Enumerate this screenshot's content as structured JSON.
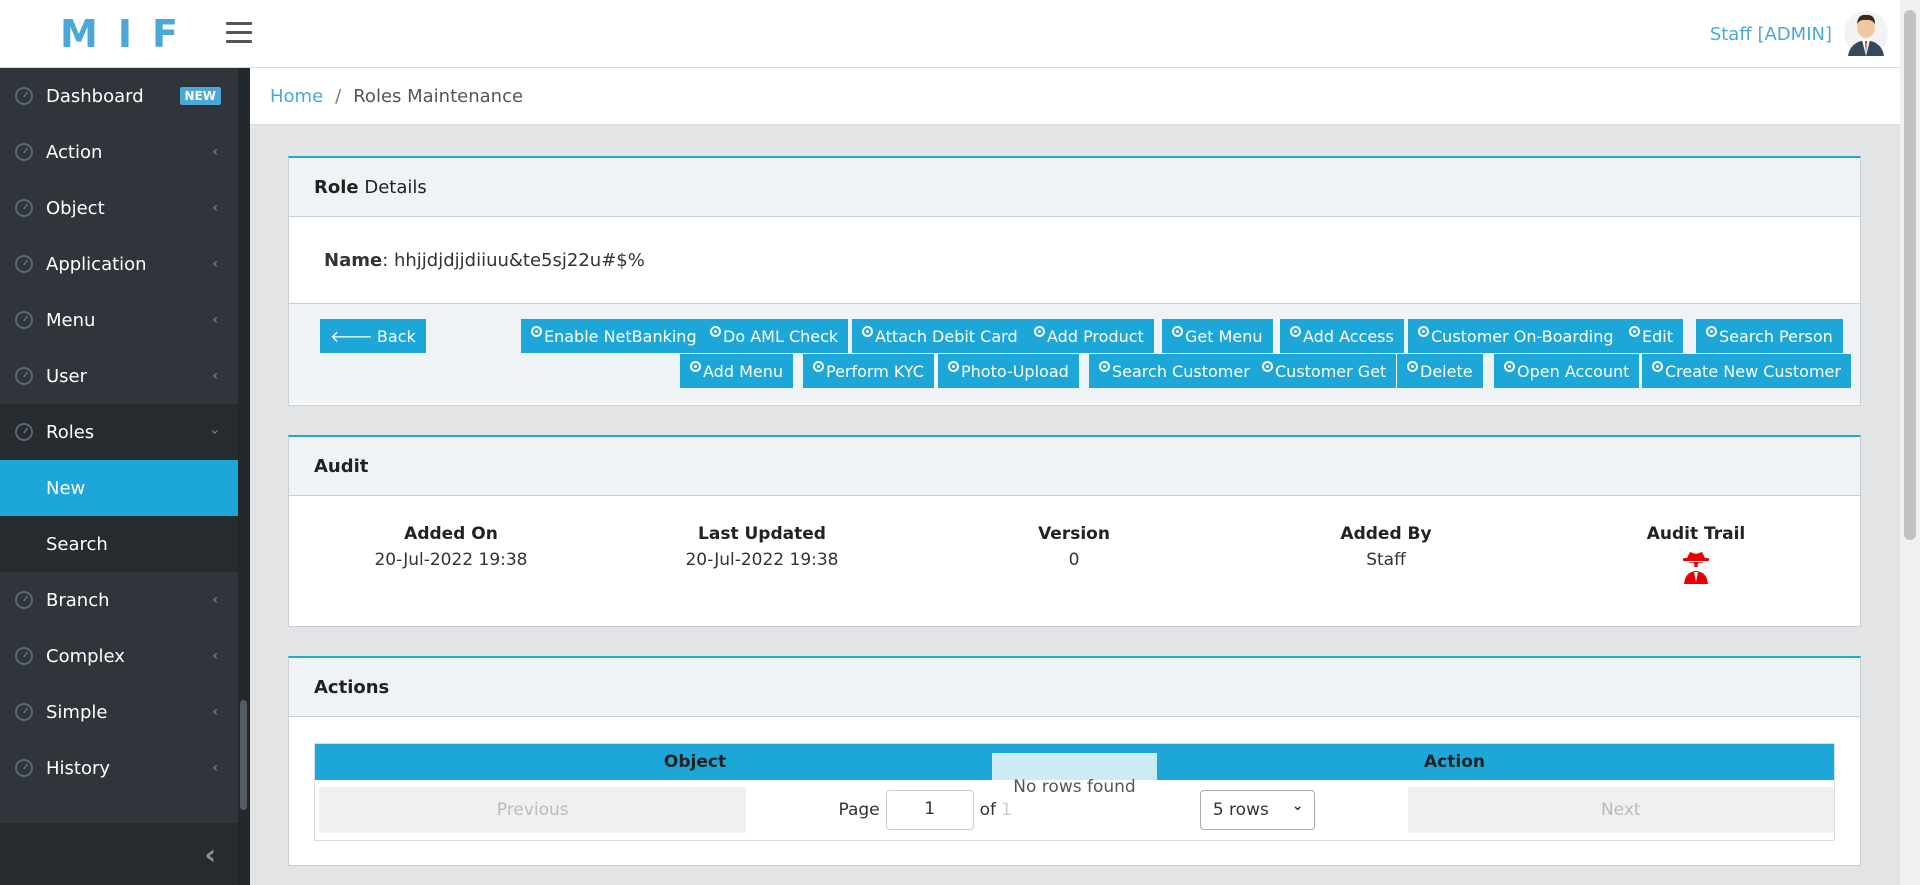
{
  "header": {
    "logo": "MIF",
    "user": "Staff [ADMIN]"
  },
  "sidebar": {
    "items": [
      {
        "label": "Dashboard",
        "badge": "NEW"
      },
      {
        "label": "Action"
      },
      {
        "label": "Object"
      },
      {
        "label": "Application"
      },
      {
        "label": "Menu"
      },
      {
        "label": "User"
      },
      {
        "label": "Roles"
      },
      {
        "label": "Branch"
      },
      {
        "label": "Complex"
      },
      {
        "label": "Simple"
      },
      {
        "label": "History"
      }
    ],
    "roles_sub": [
      "New",
      "Search"
    ]
  },
  "breadcrumb": {
    "home": "Home",
    "separator": "/",
    "current": "Roles Maintenance"
  },
  "role_card": {
    "title_bold": "Role",
    "title_rest": " Details",
    "name_label": "Name",
    "name_value": ": hhjjdjdjjdiiuu&te5sj22u#$%",
    "back": "Back",
    "buttons_row1": [
      "Enable NetBanking",
      "Do AML Check",
      "Attach Debit Card",
      "Add Product",
      "Get Menu",
      "Add Access",
      "Customer On-Boarding",
      "Edit",
      "Search Person"
    ],
    "buttons_row2": [
      "Add Menu",
      "Perform KYC",
      "Photo-Upload",
      "Search Customer",
      "Customer Get",
      "Delete",
      "Open Account",
      "Create New Customer"
    ]
  },
  "audit": {
    "title": "Audit",
    "added_on_label": "Added On",
    "added_on": "20-Jul-2022 19:38",
    "last_updated_label": "Last Updated",
    "last_updated": "20-Jul-2022 19:38",
    "version_label": "Version",
    "version": "0",
    "added_by_label": "Added By",
    "added_by": "Staff",
    "audit_trail_label": "Audit Trail"
  },
  "actions": {
    "title": "Actions",
    "columns": [
      "Object",
      "Action"
    ],
    "no_rows": "No rows found",
    "previous": "Previous",
    "page_label": "Page",
    "page": "1",
    "of_label": "of",
    "total_pages": "1",
    "rows_option": "5 rows",
    "next": "Next"
  },
  "colors": {
    "accent": "#1da6d8",
    "sidebar": "#2f353a",
    "logo": "#4aa9d6"
  }
}
